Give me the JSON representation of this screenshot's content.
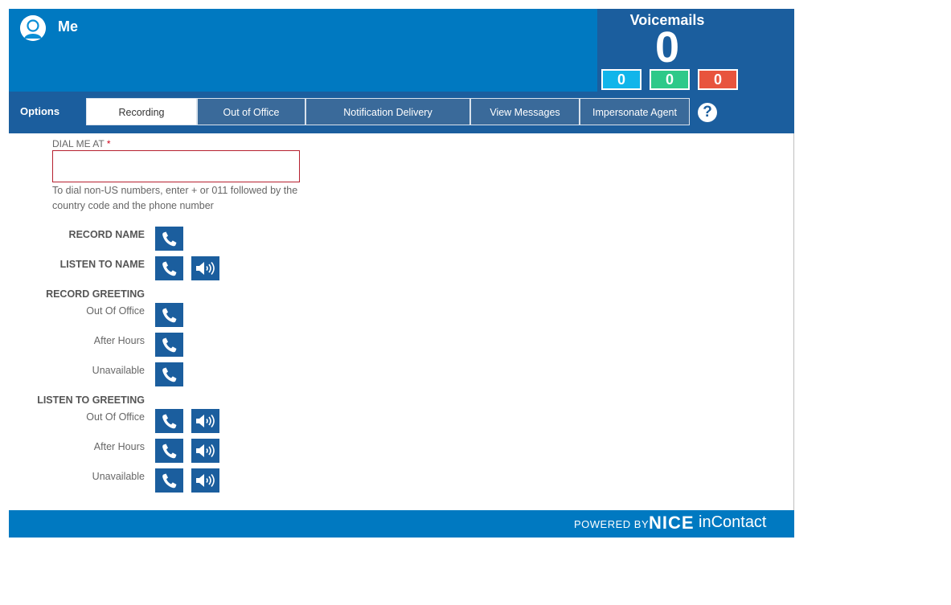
{
  "header": {
    "user_name": "Me",
    "voicemails": {
      "title": "Voicemails",
      "total": "0",
      "counts": [
        "0",
        "0",
        "0"
      ],
      "colors": [
        "#11b5ea",
        "#2ec989",
        "#e8543d"
      ]
    }
  },
  "tabs": {
    "options_label": "Options",
    "items": [
      "Recording",
      "Out of Office",
      "Notification Delivery",
      "View Messages",
      "Impersonate Agent"
    ],
    "active": "Recording",
    "help": "?"
  },
  "form": {
    "dial_label": "DIAL ME AT",
    "required_mark": "*",
    "dial_value": "",
    "hint": "To dial non-US numbers, enter + or 011 followed by the country code and the phone number"
  },
  "recording": {
    "record_name": "RECORD NAME",
    "listen_to_name": "LISTEN TO NAME",
    "record_greeting": "RECORD GREETING",
    "listen_to_greeting": "LISTEN TO GREETING",
    "greeting_types": [
      "Out Of Office",
      "After Hours",
      "Unavailable"
    ]
  },
  "footer": {
    "powered_by": "POWERED BY",
    "brand_nice": "NICE",
    "brand_incontact": "inContact"
  },
  "colors": {
    "header_blue": "#0079c1",
    "dark_blue": "#1b5e9e",
    "input_error_border": "#b6202f"
  },
  "icons": [
    "user-avatar-icon",
    "phone-icon",
    "speaker-icon",
    "help-icon"
  ]
}
